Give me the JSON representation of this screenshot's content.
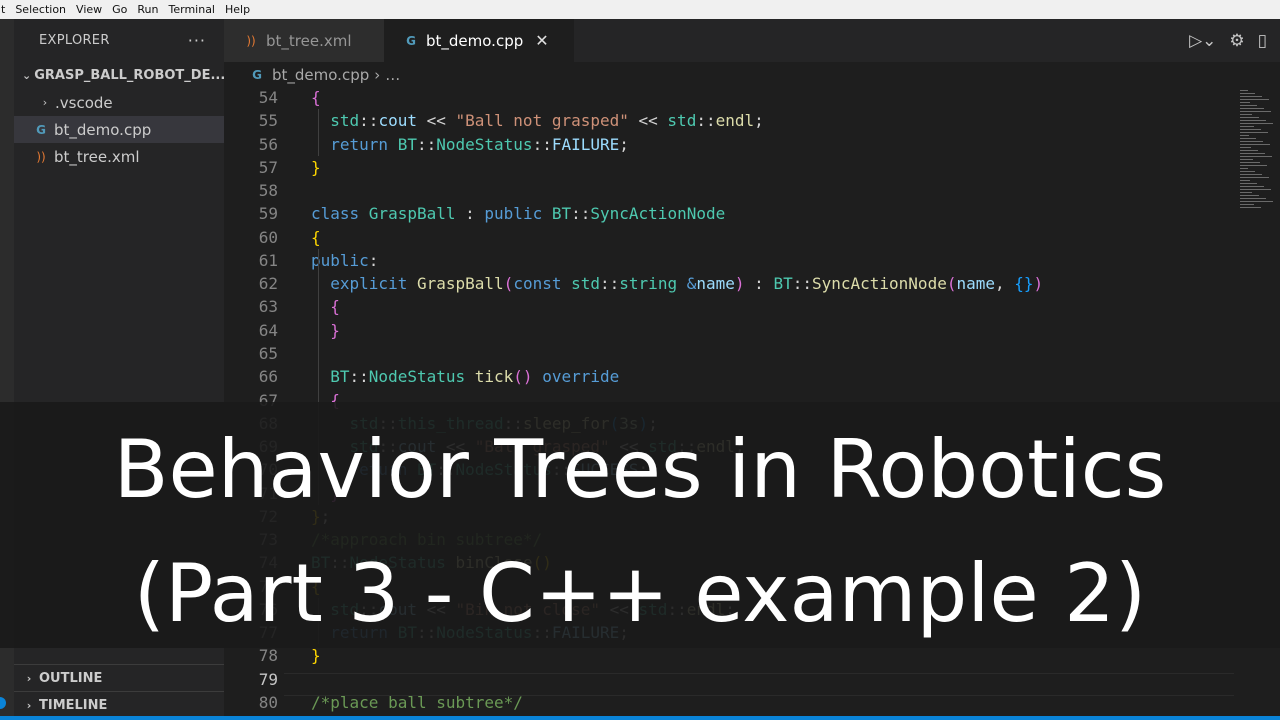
{
  "menubar": [
    "t",
    "Selection",
    "View",
    "Go",
    "Run",
    "Terminal",
    "Help"
  ],
  "sidebar": {
    "title": "EXPLORER",
    "more": "···",
    "folder": "GRASP_BALL_ROBOT_DE...",
    "items": [
      {
        "name": ".vscode",
        "icon": "chevron-right-icon"
      },
      {
        "name": "bt_demo.cpp",
        "icon": "cpp-file-icon"
      },
      {
        "name": "bt_tree.xml",
        "icon": "rss-xml-icon"
      }
    ],
    "outline": "OUTLINE",
    "timeline": "TIMELINE"
  },
  "tabs": [
    {
      "label": "bt_tree.xml",
      "icon": "rss-xml-icon"
    },
    {
      "label": "bt_demo.cpp",
      "icon": "cpp-file-icon",
      "close": "✕"
    }
  ],
  "breadcrumb": {
    "file": "bt_demo.cpp",
    "more": "…"
  },
  "line_numbers": [
    "54",
    "55",
    "56",
    "57",
    "58",
    "59",
    "60",
    "61",
    "62",
    "63",
    "64",
    "65",
    "66",
    "67",
    "68",
    "69",
    "70",
    "71",
    "72",
    "73",
    "74",
    "75",
    "76",
    "77",
    "78",
    "79",
    "80"
  ],
  "code": [
    [
      [
        "b2",
        "{"
      ]
    ],
    [
      [
        "ty",
        "  std"
      ],
      [
        "op",
        "::"
      ],
      [
        "vr",
        "cout"
      ],
      [
        "op",
        " << "
      ],
      [
        "st",
        "\"Ball not grasped\""
      ],
      [
        "op",
        " << "
      ],
      [
        "ty",
        "std"
      ],
      [
        "op",
        "::"
      ],
      [
        "fn",
        "endl"
      ],
      [
        "op",
        ";"
      ]
    ],
    [
      [
        "kw",
        "  return "
      ],
      [
        "ty",
        "BT"
      ],
      [
        "op",
        "::"
      ],
      [
        "ty",
        "NodeStatus"
      ],
      [
        "op",
        "::"
      ],
      [
        "vr",
        "FAILURE"
      ],
      [
        "op",
        ";"
      ]
    ],
    [
      [
        "b1",
        "}"
      ]
    ],
    [
      [
        "op",
        ""
      ]
    ],
    [
      [
        "kw",
        "class "
      ],
      [
        "cls",
        "GraspBall"
      ],
      [
        "op",
        " : "
      ],
      [
        "kw",
        "public "
      ],
      [
        "ty",
        "BT"
      ],
      [
        "op",
        "::"
      ],
      [
        "cls",
        "SyncActionNode"
      ]
    ],
    [
      [
        "b1",
        "{"
      ]
    ],
    [
      [
        "kw",
        "public"
      ],
      [
        "op",
        ":"
      ]
    ],
    [
      [
        "kw",
        "  explicit "
      ],
      [
        "fn",
        "GraspBall"
      ],
      [
        "b2",
        "("
      ],
      [
        "kw",
        "const "
      ],
      [
        "ty",
        "std"
      ],
      [
        "op",
        "::"
      ],
      [
        "ty",
        "string "
      ],
      [
        "kw",
        "&"
      ],
      [
        "vr",
        "name"
      ],
      [
        "b2",
        ")"
      ],
      [
        "op",
        " : "
      ],
      [
        "ty",
        "BT"
      ],
      [
        "op",
        "::"
      ],
      [
        "fn",
        "SyncActionNode"
      ],
      [
        "b2",
        "("
      ],
      [
        "vr",
        "name"
      ],
      [
        "op",
        ", "
      ],
      [
        "b3",
        "{}"
      ],
      [
        "b2",
        ")"
      ]
    ],
    [
      [
        "b2",
        "  {"
      ]
    ],
    [
      [
        "b2",
        "  }"
      ]
    ],
    [
      [
        "op",
        ""
      ]
    ],
    [
      [
        "ty",
        "  BT"
      ],
      [
        "op",
        "::"
      ],
      [
        "ty",
        "NodeStatus "
      ],
      [
        "fn",
        "tick"
      ],
      [
        "b2",
        "()"
      ],
      [
        "kw",
        " override"
      ]
    ],
    [
      [
        "b2",
        "  {"
      ]
    ],
    [
      [
        "ty",
        "    std"
      ],
      [
        "op",
        "::"
      ],
      [
        "ty",
        "this_thread"
      ],
      [
        "op",
        "::"
      ],
      [
        "fn",
        "sleep_for"
      ],
      [
        "b3",
        "("
      ],
      [
        "nu",
        "3s"
      ],
      [
        "b3",
        ")"
      ],
      [
        "op",
        ";"
      ]
    ],
    [
      [
        "ty",
        "    std"
      ],
      [
        "op",
        "::"
      ],
      [
        "vr",
        "cout"
      ],
      [
        "op",
        " << "
      ],
      [
        "st",
        "\"Ball grasped\""
      ],
      [
        "op",
        " << "
      ],
      [
        "ty",
        "std"
      ],
      [
        "op",
        "::"
      ],
      [
        "fn",
        "endl"
      ],
      [
        "op",
        ";"
      ]
    ],
    [
      [
        "kw",
        "    return "
      ],
      [
        "ty",
        "BT"
      ],
      [
        "op",
        "::"
      ],
      [
        "ty",
        "NodeStatus"
      ],
      [
        "op",
        "::"
      ],
      [
        "vr",
        "SUCCESS"
      ],
      [
        "op",
        ";"
      ]
    ],
    [
      [
        "b2",
        "  }"
      ]
    ],
    [
      [
        "b1",
        "}"
      ],
      [
        "op",
        ";"
      ]
    ],
    [
      [
        "cm",
        "/*approach bin subtree*/"
      ]
    ],
    [
      [
        "ty",
        "BT"
      ],
      [
        "op",
        "::"
      ],
      [
        "ty",
        "NodeStatus "
      ],
      [
        "fn",
        "binClose"
      ],
      [
        "b1",
        "()"
      ]
    ],
    [
      [
        "b1",
        "{"
      ]
    ],
    [
      [
        "ty",
        "  std"
      ],
      [
        "op",
        "::"
      ],
      [
        "vr",
        "cout"
      ],
      [
        "op",
        " << "
      ],
      [
        "st",
        "\"Bin not close\""
      ],
      [
        "op",
        " << "
      ],
      [
        "ty",
        "std"
      ],
      [
        "op",
        "::"
      ],
      [
        "fn",
        "endl"
      ],
      [
        "op",
        ";"
      ]
    ],
    [
      [
        "kw",
        "  return "
      ],
      [
        "ty",
        "BT"
      ],
      [
        "op",
        "::"
      ],
      [
        "ty",
        "NodeStatus"
      ],
      [
        "op",
        "::"
      ],
      [
        "vr",
        "FAILURE"
      ],
      [
        "op",
        ";"
      ]
    ],
    [
      [
        "b1",
        "}"
      ]
    ],
    [
      [
        "op",
        ""
      ]
    ],
    [
      [
        "cm",
        "/*place ball subtree*/"
      ]
    ]
  ],
  "overlay": {
    "line1": "Behavior Trees in Robotics",
    "line2": "(Part 3 - C++ example 2)"
  },
  "colors": {
    "accent": "#0a84d8",
    "editor_bg": "#1e1e1e",
    "sidebar_bg": "#252526"
  }
}
